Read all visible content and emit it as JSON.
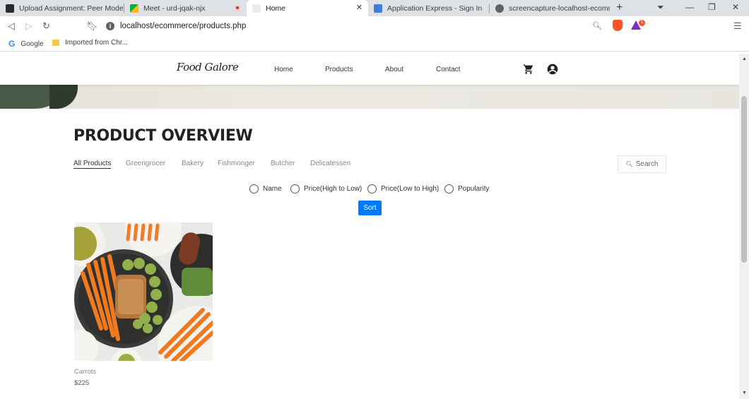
{
  "browser": {
    "tabs": [
      {
        "title": "Upload Assignment: Peer Moderat",
        "active": false
      },
      {
        "title": "Meet - urd-jqak-njx",
        "active": false
      },
      {
        "title": "Home",
        "active": true
      },
      {
        "title": "Application Express - Sign In",
        "active": false
      },
      {
        "title": "screencapture-localhost-ecomme",
        "active": false
      }
    ],
    "url": "localhost/ecommerce/products.php",
    "rewards_badge": "1",
    "bookmarks": [
      {
        "label": "Google"
      },
      {
        "label": "Imported from Chr..."
      }
    ]
  },
  "site": {
    "logo": "Food Galore",
    "nav": [
      "Home",
      "Products",
      "About",
      "Contact"
    ]
  },
  "page": {
    "title": "PRODUCT OVERVIEW",
    "filters": [
      "All Products",
      "Greengrocer",
      "Bakery",
      "Fishmonger",
      "Butcher",
      "Delicatessen"
    ],
    "active_filter": "All Products",
    "search_label": "Search",
    "sort_options": [
      "Name",
      "Price(High to Low)",
      "Price(Low to High)",
      "Popularity"
    ],
    "sort_button": "Sort",
    "accent": "#007bff"
  },
  "products": [
    {
      "name": "Carrots",
      "price": "$225"
    }
  ]
}
